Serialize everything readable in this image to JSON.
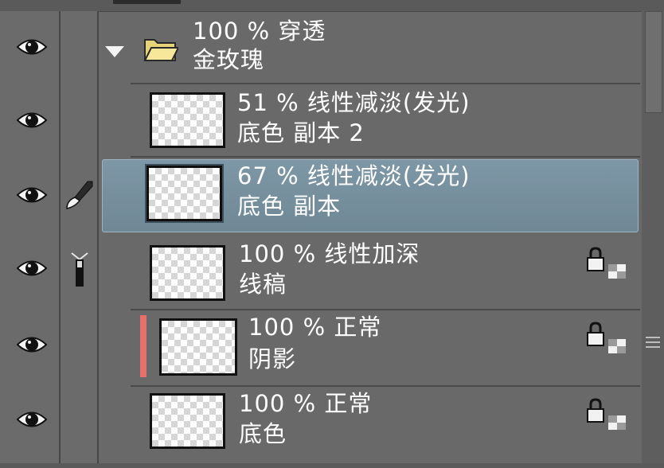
{
  "layers": {
    "folder": {
      "opacity_mode": "100 % 穿透",
      "name": "金玫瑰"
    },
    "items": [
      {
        "opacity_mode": "51 % 线性减淡(发光)",
        "name": "底色 副本 2"
      },
      {
        "opacity_mode": "67 % 线性减淡(发光)",
        "name": "底色 副本"
      },
      {
        "opacity_mode": "100 % 线性加深",
        "name": "线稿"
      },
      {
        "opacity_mode": "100 % 正常",
        "name": "阴影"
      },
      {
        "opacity_mode": "100 % 正常",
        "name": "底色"
      }
    ]
  },
  "colors": {
    "panel_bg": "#696969",
    "selected_bg": "#7590a0",
    "shadow_layer_color_label": "#e8706c"
  },
  "icons": {
    "visibility": "eye-icon",
    "folder": "folder-icon",
    "expand": "triangle-down-icon",
    "brush": "brush-icon",
    "ruler": "ruler-icon",
    "lock": "lock-transparent-icon"
  }
}
